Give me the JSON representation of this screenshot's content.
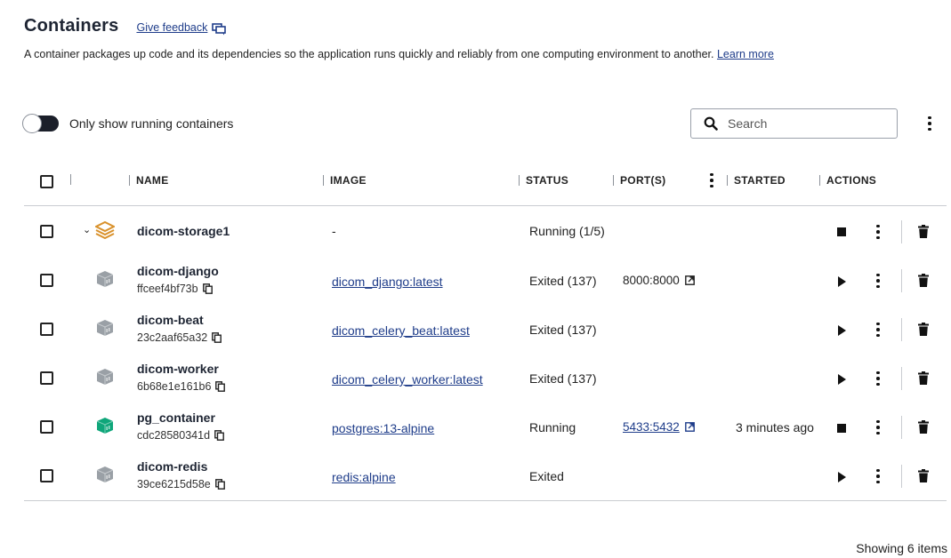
{
  "header": {
    "title": "Containers",
    "feedback_label": "Give feedback"
  },
  "description": {
    "text": "A container packages up code and its dependencies so the application runs quickly and reliably from one computing environment to another. ",
    "learn_more": "Learn more"
  },
  "filter": {
    "toggle_label": "Only show running containers",
    "toggle_on": false
  },
  "search": {
    "placeholder": "Search"
  },
  "columns": {
    "name": "NAME",
    "image": "IMAGE",
    "status": "STATUS",
    "ports": "PORT(S)",
    "started": "STARTED",
    "actions": "ACTIONS"
  },
  "group": {
    "name": "dicom-storage1",
    "image": "-",
    "status": "Running (1/5)"
  },
  "rows": [
    {
      "name": "dicom-django",
      "id": "ffceef4bf73b",
      "image": "dicom_django:latest",
      "status": "Exited (137)",
      "port": "8000:8000",
      "started": "",
      "running": false
    },
    {
      "name": "dicom-beat",
      "id": "23c2aaf65a32",
      "image": "dicom_celery_beat:latest",
      "status": "Exited (137)",
      "port": "",
      "started": "",
      "running": false
    },
    {
      "name": "dicom-worker",
      "id": "6b68e1e161b6",
      "image": "dicom_celery_worker:latest",
      "status": "Exited (137)",
      "port": "",
      "started": "",
      "running": false
    },
    {
      "name": "pg_container",
      "id": "cdc28580341d",
      "image": "postgres:13-alpine",
      "status": "Running",
      "port": "5433:5432",
      "started": "3 minutes ago",
      "running": true
    },
    {
      "name": "dicom-redis",
      "id": "39ce6215d58e",
      "image": "redis:alpine",
      "status": "Exited",
      "port": "",
      "started": "",
      "running": false
    }
  ],
  "footer": {
    "count_label": "Showing 6 items"
  },
  "colors": {
    "link": "#1f3d8a",
    "running_icon": "#0fa67a",
    "stopped_icon": "#9aa0a6",
    "stack_icon": "#d9912b"
  }
}
